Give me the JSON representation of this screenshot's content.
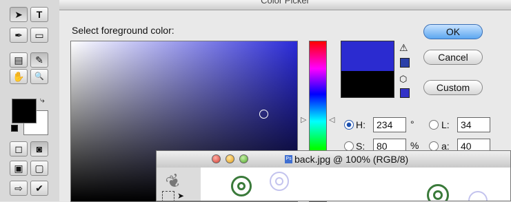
{
  "toolbox": {
    "tools": [
      {
        "icon": "arrow-icon",
        "glyph": "➤"
      },
      {
        "icon": "type-icon",
        "glyph": "T"
      },
      {
        "icon": "pen-icon",
        "glyph": "✒"
      },
      {
        "icon": "rectangle-icon",
        "glyph": "▭"
      },
      {
        "icon": "notes-icon",
        "glyph": "▤"
      },
      {
        "icon": "eyedropper-icon",
        "glyph": "✎"
      },
      {
        "icon": "hand-icon",
        "glyph": "✋"
      },
      {
        "icon": "zoom-icon",
        "glyph": "🔍"
      },
      {
        "icon": "standard-mode-icon",
        "glyph": "◻"
      },
      {
        "icon": "quickmask-mode-icon",
        "glyph": "◙"
      },
      {
        "icon": "screen-mode-icon",
        "glyph": "▣"
      },
      {
        "icon": "jump-to-icon",
        "glyph": "⇨"
      }
    ],
    "foreground_color": "#000000",
    "background_color": "#ffffff"
  },
  "dialog": {
    "title": "Color Picker",
    "prompt": "Select foreground color:",
    "ok_label": "OK",
    "cancel_label": "Cancel",
    "custom_label": "Custom",
    "new_color": "#2b2bd0",
    "current_color": "#000000",
    "warning_glyph": "⚠",
    "cube_glyph": "⬡",
    "fields": {
      "h": {
        "label": "H:",
        "value": "234",
        "unit": "°"
      },
      "s": {
        "label": "S:",
        "value": "80",
        "unit": "%"
      },
      "l": {
        "label": "L:",
        "value": "34"
      },
      "a": {
        "label": "a:",
        "value": "40"
      }
    }
  },
  "document": {
    "title": "back.jpg @ 100% (RGB/8)",
    "ps_badge": "Ps"
  }
}
